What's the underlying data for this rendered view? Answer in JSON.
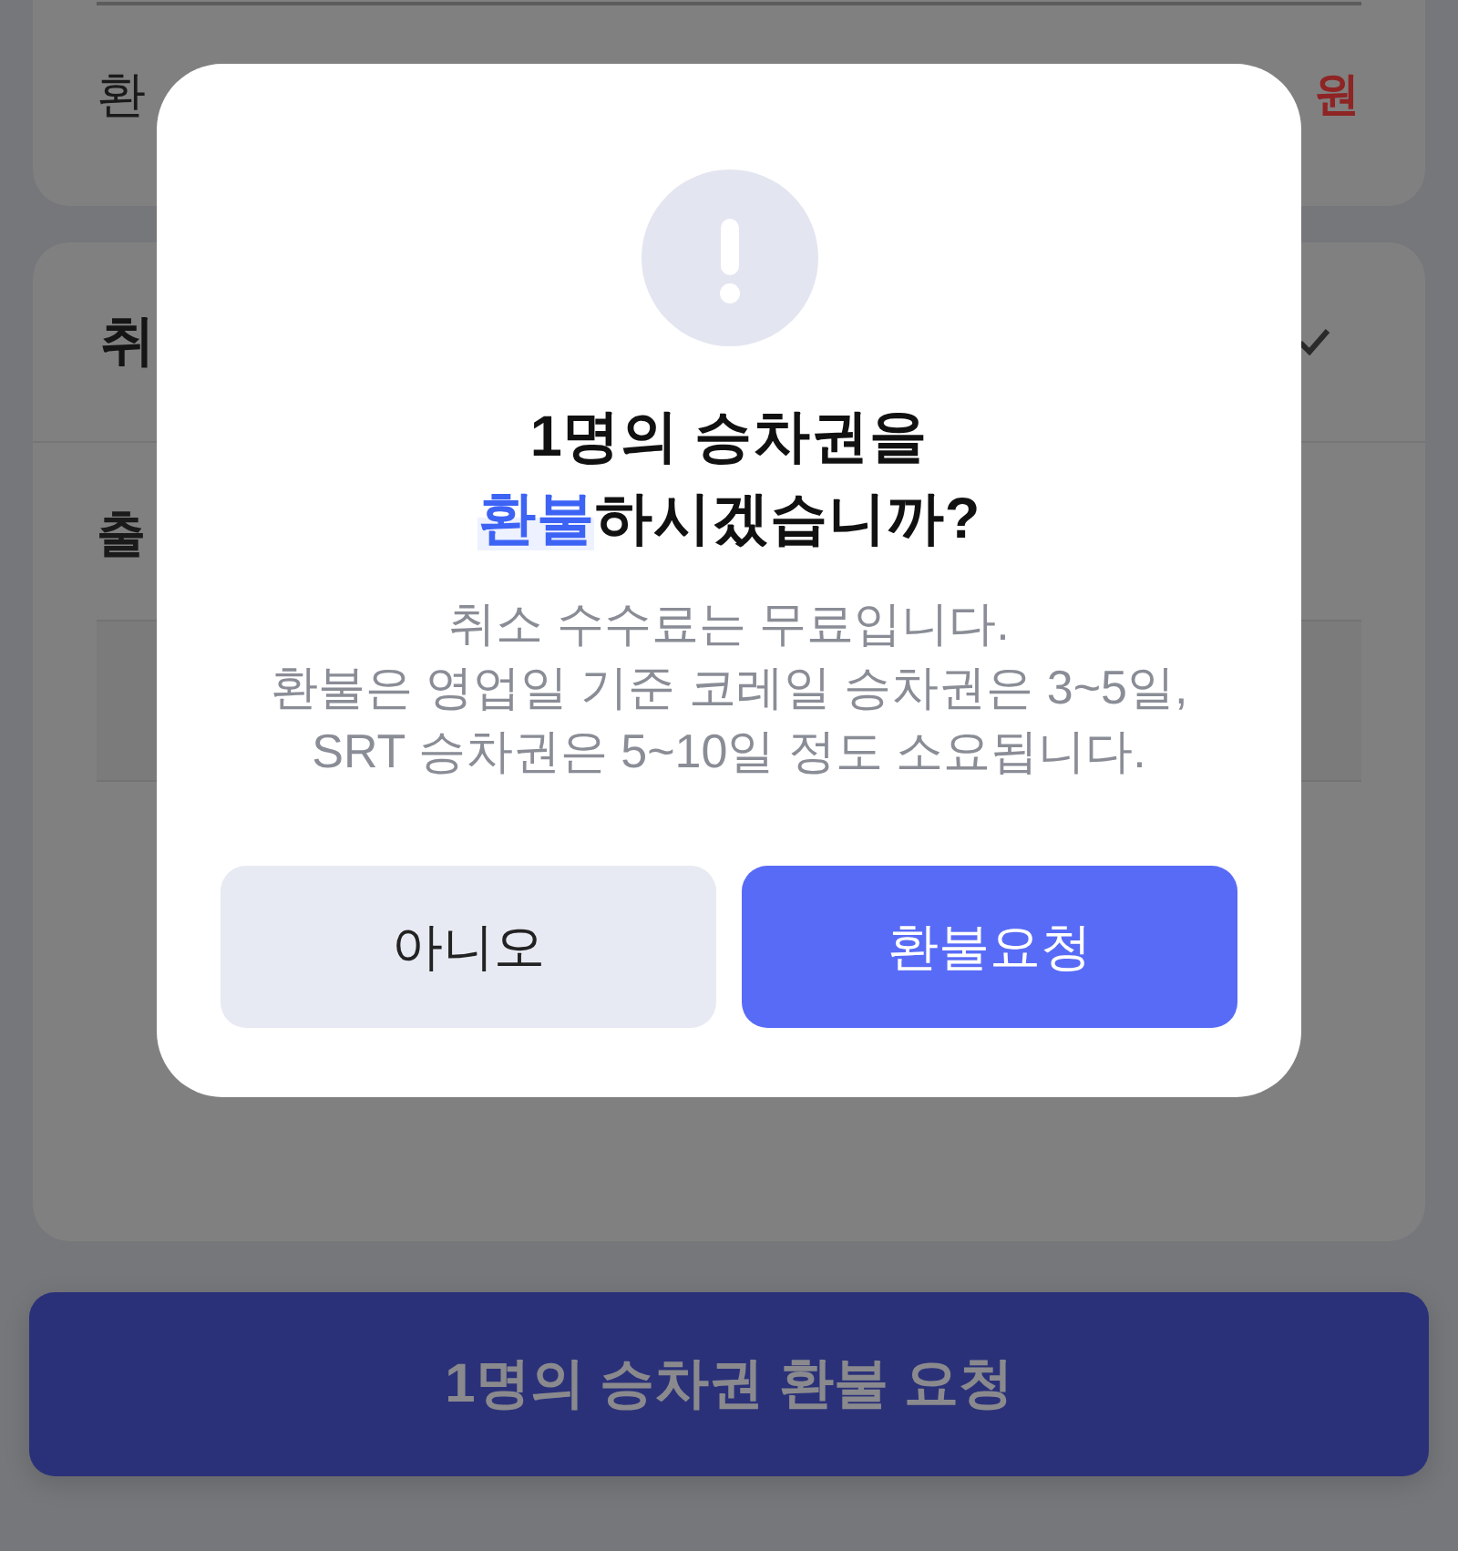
{
  "summary_card": {
    "label": "환",
    "amount_unit": "원"
  },
  "cancel_card": {
    "heading": "취",
    "field_label": "출"
  },
  "dialog": {
    "title": [
      [
        {
          "text": "1명의 승차권을",
          "emphasis": false
        }
      ],
      [
        {
          "text": "환불",
          "emphasis": true
        },
        {
          "text": "하시겠습니까?",
          "emphasis": false
        }
      ]
    ],
    "message_lines": [
      "취소 수수료는 무료입니다.",
      "환불은 영업일 기준 코레일 승차권은 3~5일,",
      "SRT 승차권은 5~10일 정도 소요됩니다."
    ],
    "buttons": [
      {
        "label": "아니오",
        "kind": "secondary"
      },
      {
        "label": "환불요청",
        "kind": "primary"
      }
    ]
  },
  "bottom_button": {
    "label": "1명의 승차권 환불 요청"
  }
}
